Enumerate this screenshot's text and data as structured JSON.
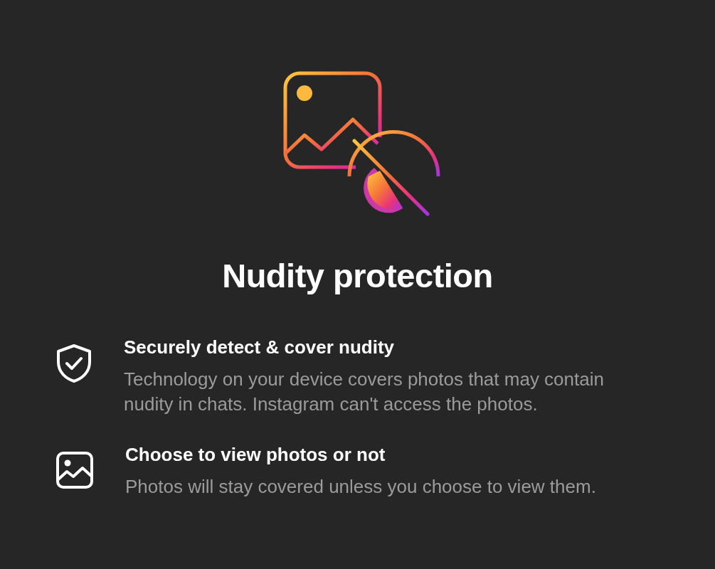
{
  "title": "Nudity protection",
  "features": [
    {
      "kind": "shield",
      "heading": "Securely detect & cover nudity",
      "description": "Technology on your device covers photos that may contain nudity in chats. Instagram can't access the photos."
    },
    {
      "kind": "photo",
      "heading": "Choose to view photos or not",
      "description": "Photos will stay covered unless you choose to view them."
    }
  ]
}
